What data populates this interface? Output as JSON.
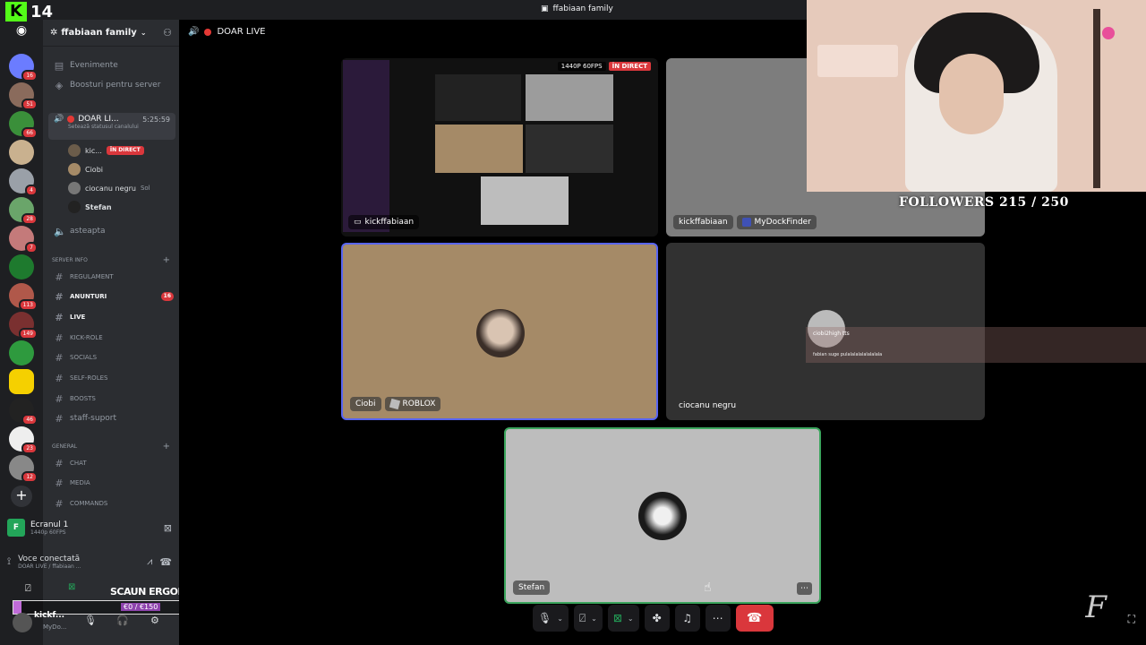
{
  "overlay_badge": {
    "letter": "K",
    "count": "14"
  },
  "window": {
    "title": "ffabiaan family"
  },
  "rail": {
    "icons": [
      "discord-home-icon"
    ],
    "badges": [
      "16",
      "51",
      "66",
      "4",
      "28",
      "7",
      "113",
      "149",
      "46",
      "23",
      "12"
    ]
  },
  "server": {
    "name": "ffabiaan family"
  },
  "sidebar": {
    "events": "Evenimente",
    "boosts": "Boosturi pentru server",
    "voice_channel": {
      "name": "DOAR LI...",
      "time": "5:25:59",
      "status": "Setează statusul canalului"
    },
    "voice_users": [
      {
        "name": "kic...",
        "badge": "ÎN DIRECT"
      },
      {
        "name": "Ciobi"
      },
      {
        "name": "ciocanu negru",
        "activity": "Sol"
      },
      {
        "name": "Stefan"
      }
    ],
    "asteapta": "asteapta",
    "cat_server_info": "SERVER INFO",
    "channels_info": [
      {
        "name": "REGULAMENT"
      },
      {
        "name": "ANUNTURI",
        "count": "16"
      },
      {
        "name": "LIVE"
      },
      {
        "name": "KICK-ROLE"
      },
      {
        "name": "SOCIALS"
      },
      {
        "name": "SELF-ROLES"
      },
      {
        "name": "BOOSTS"
      },
      {
        "name": "staff-suport"
      }
    ],
    "cat_general": "GENERAL",
    "channels_general": [
      {
        "name": "CHAT"
      },
      {
        "name": "MEDIA"
      },
      {
        "name": "COMMANDS"
      }
    ]
  },
  "screen_share": {
    "title": "Ecranul 1",
    "quality": "1440p 60FPS"
  },
  "voice_panel": {
    "status": "Voce conectată",
    "location": "DOAR LIVE / ffabiaan ..."
  },
  "promo": {
    "title": "SCAUN ERGONOMIC",
    "amount": "€0 / €150",
    "progress": 0.0
  },
  "user": {
    "name": "kickf...",
    "status": "MyDo..."
  },
  "call": {
    "channel": "DOAR LIVE"
  },
  "tiles": {
    "stream": {
      "name": "kickffabiaan",
      "quality": "1440P 60FPS",
      "live": "ÎN DIRECT"
    },
    "kick_cam": {
      "name": "kickffabiaan",
      "activity": "MyDockFinder"
    },
    "ciobi": {
      "name": "Ciobi",
      "activity": "ROBLOX"
    },
    "ciocanu": {
      "name": "ciocanu negru"
    },
    "stefan": {
      "name": "Stefan"
    }
  },
  "chat_overlay": {
    "user": "ciobi2high",
    "badge": "tts",
    "message": "fabian suge pulalalalalalalalala"
  },
  "followers": "FOLLOWERS 215 / 250",
  "watermark": "F",
  "colors": {
    "accent": "#5865f2",
    "live": "#da373c",
    "online": "#23a559",
    "kick": "#53fc18"
  }
}
